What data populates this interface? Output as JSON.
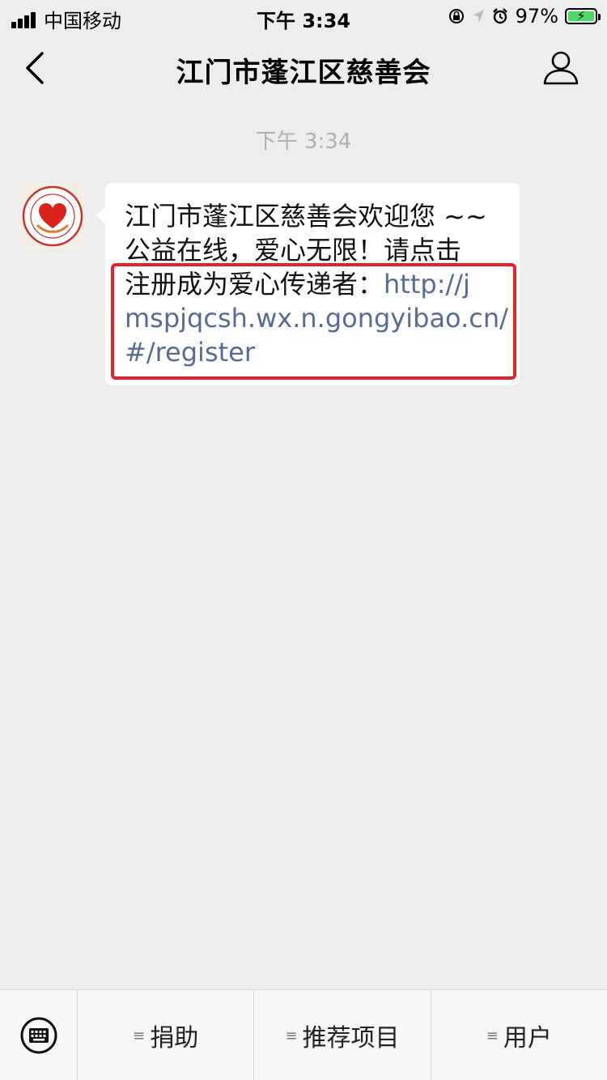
{
  "status_bar": {
    "carrier": "中国移动",
    "time": "下午 3:34",
    "battery": "97%",
    "battery_level": 0.97,
    "icons": [
      "signal-icon",
      "orientation-lock-icon",
      "location-icon",
      "alarm-icon",
      "battery-icon"
    ]
  },
  "nav": {
    "title": "江门市蓬江区慈善会",
    "back_icon": "chevron-left-icon",
    "profile_icon": "user-icon"
  },
  "chat": {
    "timestamp": "下午 3:34",
    "message": {
      "line1": "江门市蓬江区慈善会欢迎您 ~~",
      "line2": "公益在线，爱心无限！请点击",
      "line3_text": "注册成为爱心传递者：",
      "line3_link": "http://j",
      "line4_link": "mspjqcsh.wx.n.gongyibao.cn/",
      "line5_link": "#/register"
    },
    "link_color": "#576b95",
    "highlight_color": "#e8202a"
  },
  "menu": {
    "keyboard_icon": "keyboard-icon",
    "items": [
      {
        "label": "捐助",
        "icon": "menu-lines-icon"
      },
      {
        "label": "推荐项目",
        "icon": "menu-lines-icon"
      },
      {
        "label": "用户",
        "icon": "menu-lines-icon"
      }
    ]
  }
}
